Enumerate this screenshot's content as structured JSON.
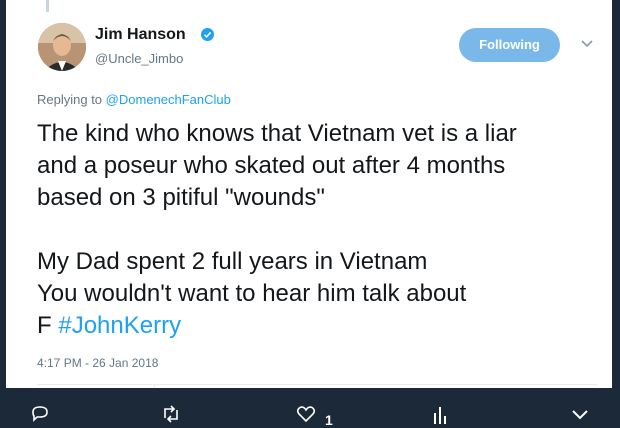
{
  "tweet": {
    "author_name": "Jim Hanson",
    "author_handle": "@Uncle_Jimbo",
    "follow_label": "Following",
    "replying_prefix": "Replying to",
    "replying_to": "@DomenechFanClub",
    "lines": [
      "The kind who knows that Vietnam vet is a liar",
      "and a poseur who skated out after 4 months",
      "based on 3 pitiful \"wounds\"",
      "",
      "My Dad spent 2 full years in Vietnam",
      "You wouldn't want to hear him talk about"
    ],
    "last_line_prefix": "F",
    "hashtag": "#JohnKerry",
    "timestamp": "4:17 PM - 26 Jan 2018",
    "like_count": "1"
  },
  "icons": {
    "verified": "verified-badge-icon",
    "caret": "chevron-down-icon",
    "reply": "reply-icon",
    "retweet": "retweet-icon",
    "like": "heart-icon",
    "analytics": "analytics-icon",
    "more": "chevron-down-icon"
  },
  "colors": {
    "accent": "#1da1f2",
    "follow_button": "#7ab8ea",
    "dark_bar": "#1c2938",
    "muted_text": "#657786"
  }
}
